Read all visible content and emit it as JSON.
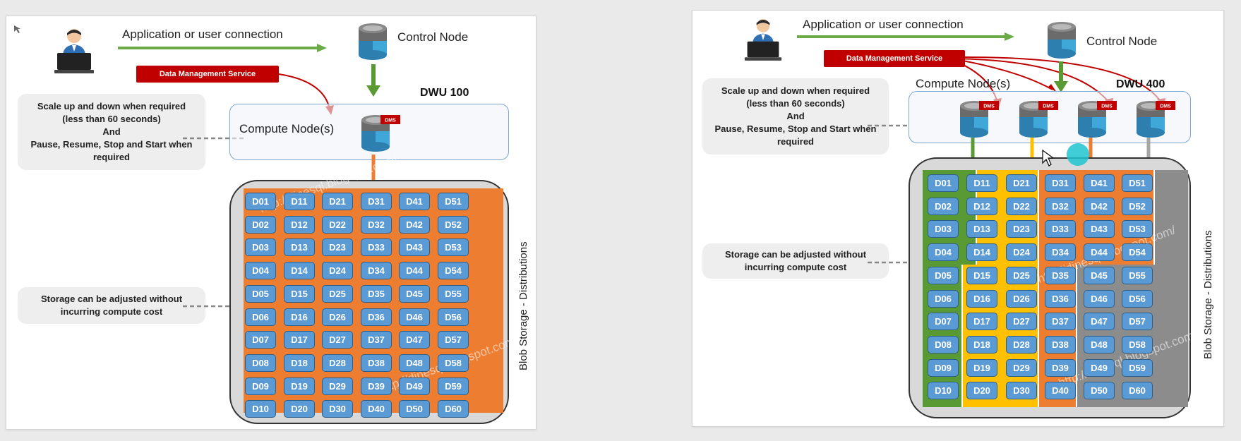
{
  "colors": {
    "arrow_green": "#5a9a34",
    "arrow_orange": "#ed7d31",
    "arrow_yellow": "#ffc000",
    "arrow_gray": "#a6a6a6",
    "dms_red": "#c00000",
    "dist_blue": "#5b9bd5",
    "storage_gray": "#d9d9d9"
  },
  "left": {
    "connection_label": "Application or user connection",
    "control_node_label": "Control Node",
    "dms_label": "Data Management Service",
    "dwu_label": "DWU 100",
    "compute_label": "Compute Node(s)",
    "dms_badge": "DMS",
    "scale_note": [
      "Scale up and down when required",
      "(less than 60 seconds)",
      "And",
      "Pause, Resume, Stop and Start when",
      "required"
    ],
    "storage_note": [
      "Storage can be adjusted without",
      "incurring compute cost"
    ],
    "storage_label": "Blob Storage - Distributions",
    "watermark": "http://dinesql.blogspot.com/",
    "compute_node_count": 1
  },
  "right": {
    "connection_label": "Application or user connection",
    "control_node_label": "Control Node",
    "dms_label": "Data Management Service",
    "dwu_label": "DWU 400",
    "compute_label": "Compute Node(s)",
    "dms_badge": "DMS",
    "scale_note": [
      "Scale up and down when required",
      "(less than 60 seconds)",
      "And",
      "Pause, Resume, Stop and Start when",
      "required"
    ],
    "storage_note": [
      "Storage can be adjusted without",
      "incurring compute cost"
    ],
    "storage_label": "Blob Storage - Distributions",
    "watermark": "http://dinesql.blogspot.com/",
    "compute_node_count": 4
  },
  "distributions": [
    [
      "D01",
      "D11",
      "D21",
      "D31",
      "D41",
      "D51"
    ],
    [
      "D02",
      "D12",
      "D22",
      "D32",
      "D42",
      "D52"
    ],
    [
      "D03",
      "D13",
      "D23",
      "D33",
      "D43",
      "D53"
    ],
    [
      "D04",
      "D14",
      "D24",
      "D34",
      "D44",
      "D54"
    ],
    [
      "D05",
      "D15",
      "D25",
      "D35",
      "D45",
      "D55"
    ],
    [
      "D06",
      "D16",
      "D26",
      "D36",
      "D46",
      "D56"
    ],
    [
      "D07",
      "D17",
      "D27",
      "D37",
      "D47",
      "D57"
    ],
    [
      "D08",
      "D18",
      "D28",
      "D38",
      "D48",
      "D58"
    ],
    [
      "D09",
      "D19",
      "D29",
      "D39",
      "D49",
      "D59"
    ],
    [
      "D10",
      "D20",
      "D30",
      "D40",
      "D50",
      "D60"
    ]
  ]
}
